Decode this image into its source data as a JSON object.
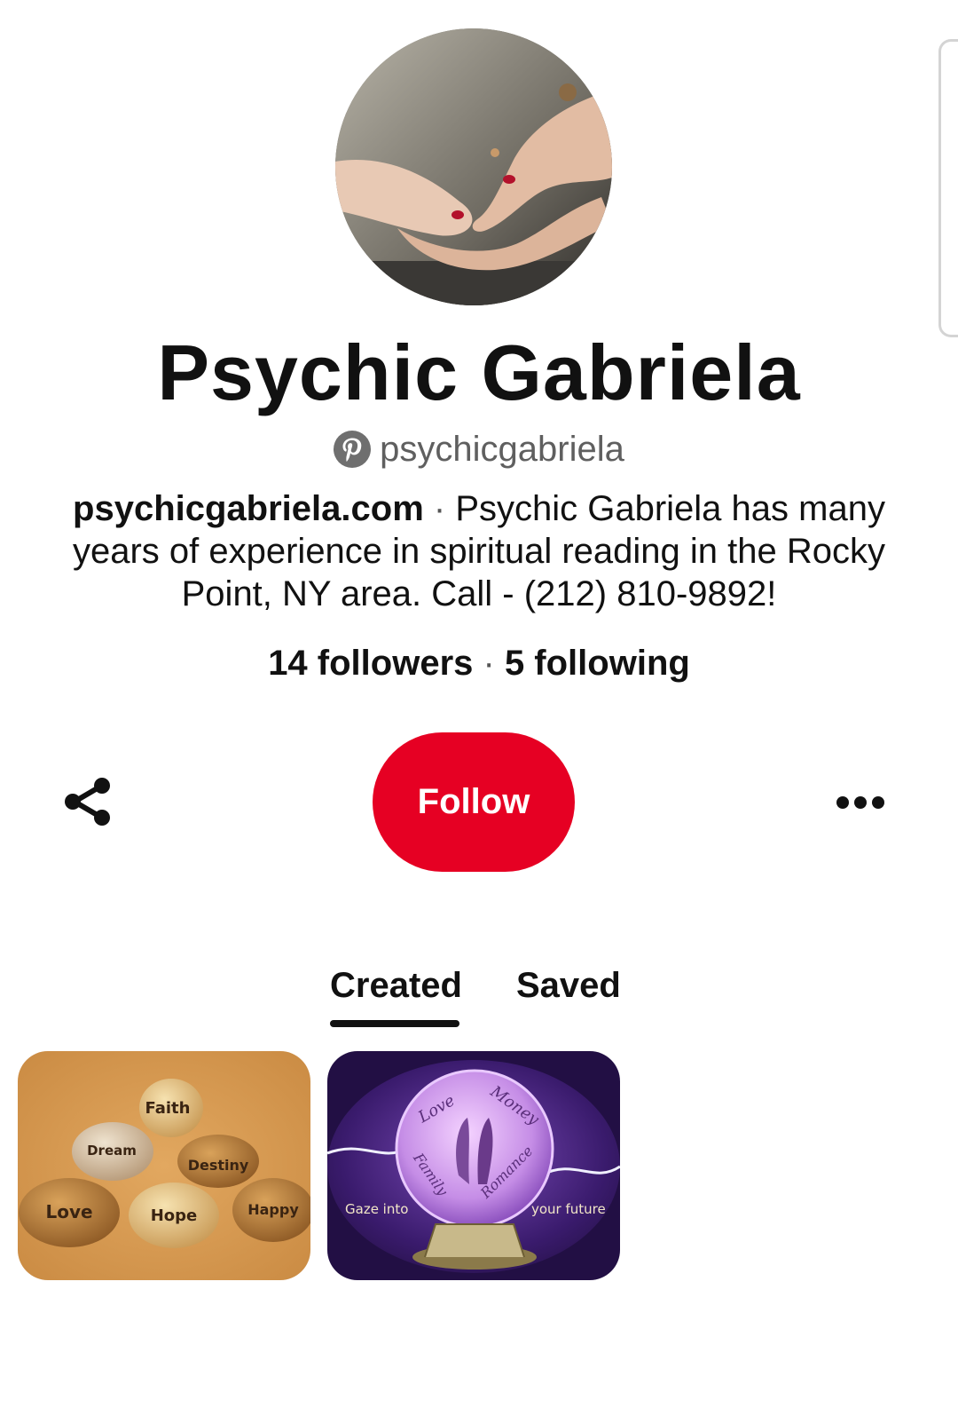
{
  "profile": {
    "name": "Psychic Gabriela",
    "handle": "psychicgabriela",
    "bio_site": "psychicgabriela.com",
    "bio_separator": " · ",
    "bio_text": "Psychic Gabriela has many years of experience in spiritual reading in the Rocky Point, NY area. Call - (212) 810-9892!",
    "followers": "14 followers",
    "stats_separator": " · ",
    "following": "5 following"
  },
  "actions": {
    "follow_label": "Follow",
    "share_icon": "share-icon",
    "more_icon": "more-horizontal-icon"
  },
  "tabs": [
    {
      "label": "Created",
      "active": true
    },
    {
      "label": "Saved",
      "active": false
    }
  ],
  "pins": [
    {
      "stones": [
        "Faith",
        "Dream",
        "Destiny",
        "Love",
        "Hope",
        "Happy"
      ]
    },
    {
      "words": [
        "Love",
        "Money",
        "Family",
        "Romance"
      ],
      "caption_left": "Gaze into",
      "caption_right": "your future"
    }
  ],
  "colors": {
    "brand_red": "#e60023",
    "text_primary": "#111111",
    "text_secondary": "#5f5f5f"
  }
}
